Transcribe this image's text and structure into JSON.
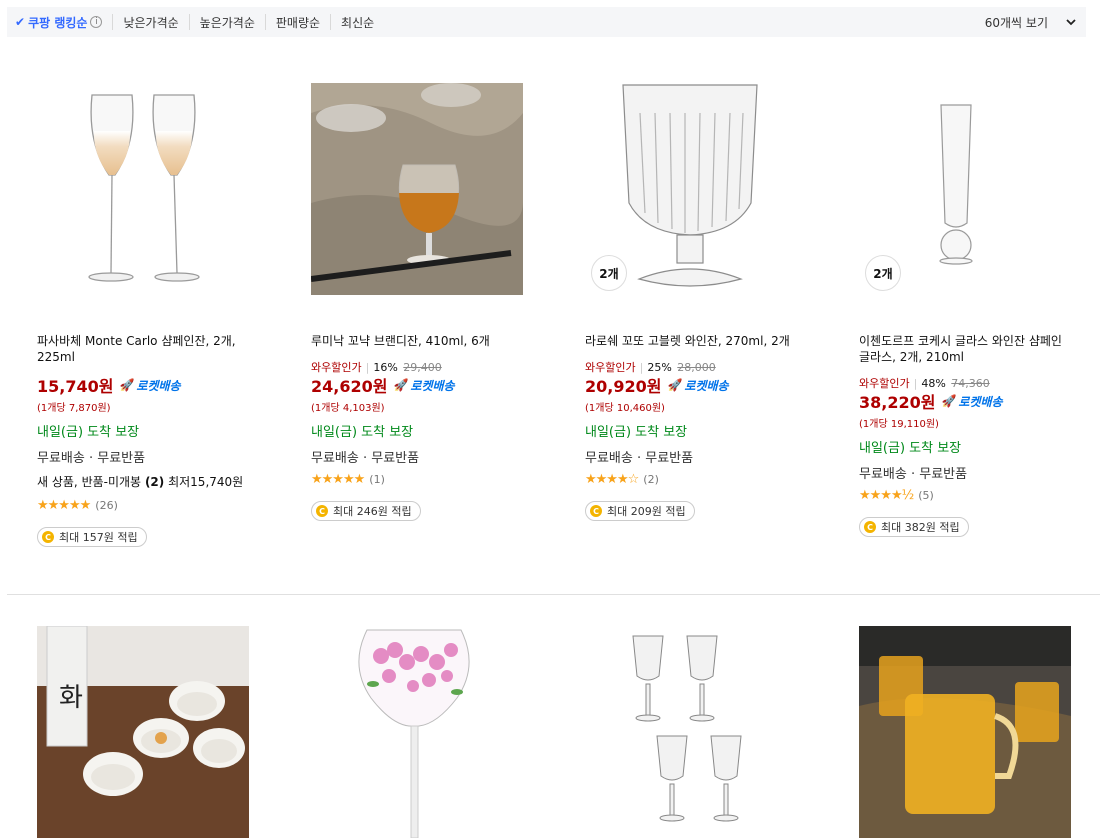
{
  "sort_bar": {
    "items": [
      {
        "label": "쿠팡 랭킹순",
        "active": true
      },
      {
        "label": "낮은가격순",
        "active": false
      },
      {
        "label": "높은가격순",
        "active": false
      },
      {
        "label": "판매량순",
        "active": false
      },
      {
        "label": "최신순",
        "active": false
      }
    ],
    "info_glyph": "i",
    "check_glyph": "✔",
    "view_count_label": "60개씩 보기",
    "chevron": "⌄"
  },
  "products": [
    {
      "name": "파사바체 Monte Carlo 샴페인잔, 2개, 225ml",
      "price": "15,740원",
      "rocket": "로켓배송",
      "unit_price": "(1개당 7,870원)",
      "arrival": "내일(금) 도착 보장",
      "shipping": "무료배송 · 무료반품",
      "used_label": "새 상품, 반품-미개봉",
      "used_count": "(2)",
      "used_min": "최저15,740원",
      "stars": "★★★★★",
      "review_count": "(26)",
      "points": "최대 157원 적립",
      "coin": "C"
    },
    {
      "name": "루미낙 꼬냑 브랜디잔, 410ml, 6개",
      "discount_label": "와우할인가",
      "discount_rate": "16%",
      "original_price": "29,400",
      "price": "24,620원",
      "rocket": "로켓배송",
      "unit_price": "(1개당 4,103원)",
      "arrival": "내일(금) 도착 보장",
      "shipping": "무료배송 · 무료반품",
      "stars": "★★★★★",
      "review_count": "(1)",
      "points": "최대 246원 적립",
      "coin": "C"
    },
    {
      "name": "라로쉐 꼬또 고블렛 와인잔, 270ml, 2개",
      "badge": "2개",
      "discount_label": "와우할인가",
      "discount_rate": "25%",
      "original_price": "28,000",
      "price": "20,920원",
      "rocket": "로켓배송",
      "unit_price": "(1개당 10,460원)",
      "arrival": "내일(금) 도착 보장",
      "shipping": "무료배송 · 무료반품",
      "stars": "★★★★☆",
      "review_count": "(2)",
      "points": "최대 209원 적립",
      "coin": "C"
    },
    {
      "name": "이첸도르프 코케시 글라스 와인잔 샴페인 글라스, 2개, 210ml",
      "badge": "2개",
      "discount_label": "와우할인가",
      "discount_rate": "48%",
      "original_price": "74,360",
      "price": "38,220원",
      "rocket": "로켓배송",
      "unit_price": "(1개당 19,110원)",
      "arrival": "내일(금) 도착 보장",
      "shipping": "무료배송 · 무료반품",
      "stars": "★★★★½",
      "review_count": "(5)",
      "points": "최대 382원 적립",
      "coin": "C"
    }
  ],
  "colors": {
    "price_red": "#ae0000",
    "rocket_blue": "#0073e9",
    "arrival_green": "#00891a",
    "star_orange": "#f8a31b",
    "active_blue": "#346aff"
  }
}
